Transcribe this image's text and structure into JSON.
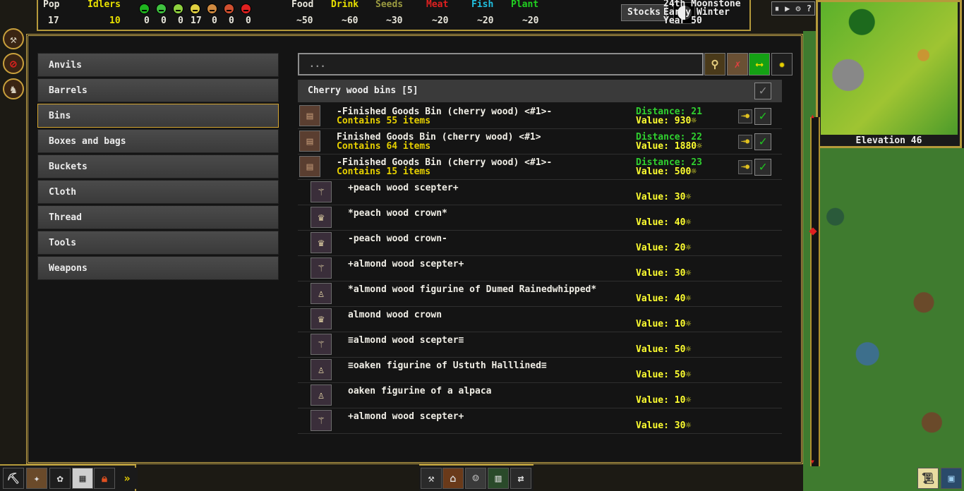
{
  "topbar": {
    "pop_label": "Pop",
    "pop_value": "17",
    "idlers_label": "Idlers",
    "idlers_value": "10",
    "mood_counts": [
      "0",
      "0",
      "0",
      "17",
      "0",
      "0",
      "0"
    ],
    "mood_colors": [
      "#1fb51f",
      "#3fc13f",
      "#8fd13f",
      "#e0d040",
      "#d08a40",
      "#d05030",
      "#e02020"
    ],
    "food_label": "Food",
    "food_value": "~50",
    "drink_label": "Drink",
    "drink_value": "~60",
    "seeds_label": "Seeds",
    "seeds_value": "~30",
    "meat_label": "Meat",
    "meat_value": "~20",
    "fish_label": "Fish",
    "fish_value": "~20",
    "plant_label": "Plant",
    "plant_value": "~20",
    "stocks_label": "Stocks",
    "date_line1": "24th Moonstone",
    "date_line2": "Early Winter",
    "date_line3": "Year 50"
  },
  "categories": [
    {
      "label": "Anvils"
    },
    {
      "label": "Barrels"
    },
    {
      "label": "Bins"
    },
    {
      "label": "Boxes and bags"
    },
    {
      "label": "Buckets"
    },
    {
      "label": "Cloth"
    },
    {
      "label": "Thread"
    },
    {
      "label": "Tools"
    },
    {
      "label": "Weapons"
    }
  ],
  "selected_category": "Bins",
  "search": {
    "placeholder": "..."
  },
  "group": {
    "label": "Cherry wood bins [5]"
  },
  "rows": [
    {
      "icon": "bin-icon",
      "name": "-Finished Goods Bin (cherry wood) <#1>-",
      "sub": "Contains 55 items",
      "distance": "Distance: 21",
      "value": "Value: 930☼"
    },
    {
      "icon": "bin-icon",
      "name": "Finished Goods Bin (cherry wood) <#1>",
      "sub": "Contains 64 items",
      "distance": "Distance: 22",
      "value": "Value: 1880☼"
    },
    {
      "icon": "bin-icon",
      "name": "-Finished Goods Bin (cherry wood) <#1>-",
      "sub": "Contains 15 items",
      "distance": "Distance: 23",
      "value": "Value: 500☼"
    },
    {
      "icon": "scepter-icon",
      "name": "+peach wood scepter+",
      "value": "Value: 30☼"
    },
    {
      "icon": "crown-icon",
      "name": "*peach wood crown*",
      "value": "Value: 40☼"
    },
    {
      "icon": "crown-icon",
      "name": "-peach wood crown-",
      "value": "Value: 20☼"
    },
    {
      "icon": "scepter-icon",
      "name": "+almond wood scepter+",
      "value": "Value: 30☼"
    },
    {
      "icon": "figurine-icon",
      "name": "*almond wood figurine of Dumed Rainedwhipped*",
      "value": "Value: 40☼"
    },
    {
      "icon": "crown-icon",
      "name": "almond wood crown",
      "value": "Value: 10☼"
    },
    {
      "icon": "scepter-icon",
      "name": "≡almond wood scepter≡",
      "value": "Value: 50☼"
    },
    {
      "icon": "figurine-icon",
      "name": "≡oaken figurine of Ustuth Halllined≡",
      "value": "Value: 50☼"
    },
    {
      "icon": "figurine-icon",
      "name": "oaken figurine of a alpaca",
      "value": "Value: 10☼"
    },
    {
      "icon": "scepter-icon",
      "name": "+almond wood scepter+",
      "value": "Value: 30☼"
    }
  ],
  "minimap": {
    "elevation": "Elevation 46"
  }
}
